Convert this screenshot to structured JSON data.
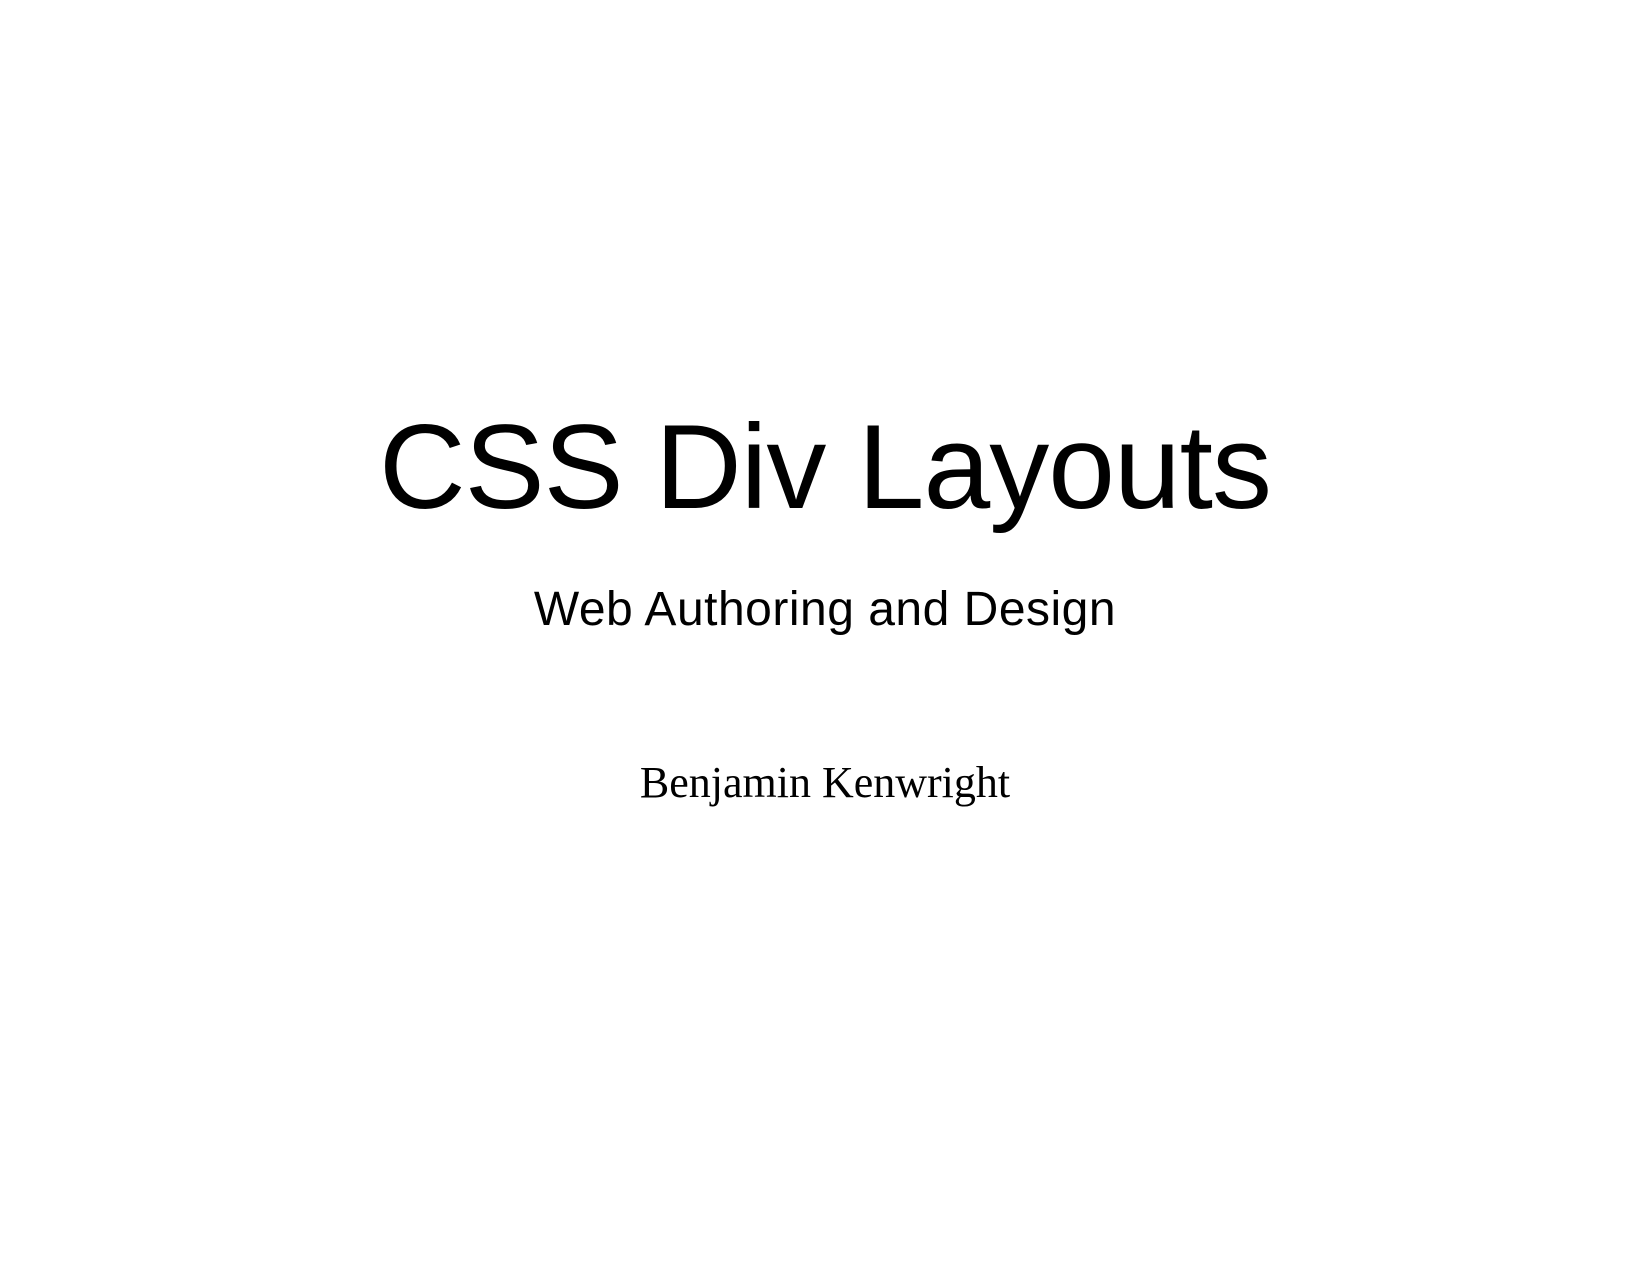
{
  "slide": {
    "title": "CSS Div Layouts",
    "subtitle": "Web Authoring and Design",
    "author": "Benjamin Kenwright"
  }
}
